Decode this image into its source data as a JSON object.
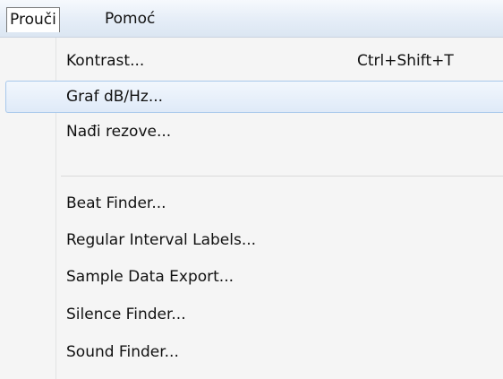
{
  "menubar": {
    "items": [
      {
        "label": "Prouči"
      },
      {
        "label": "Pomoć"
      }
    ]
  },
  "menu": {
    "items": [
      {
        "label": "Kontrast...",
        "shortcut": "Ctrl+Shift+T"
      },
      {
        "label": "Graf dB/Hz..."
      },
      {
        "label": "Nađi rezove..."
      },
      {
        "label": "Beat Finder..."
      },
      {
        "label": "Regular Interval Labels..."
      },
      {
        "label": "Sample Data Export..."
      },
      {
        "label": "Silence Finder..."
      },
      {
        "label": "Sound Finder..."
      }
    ]
  }
}
